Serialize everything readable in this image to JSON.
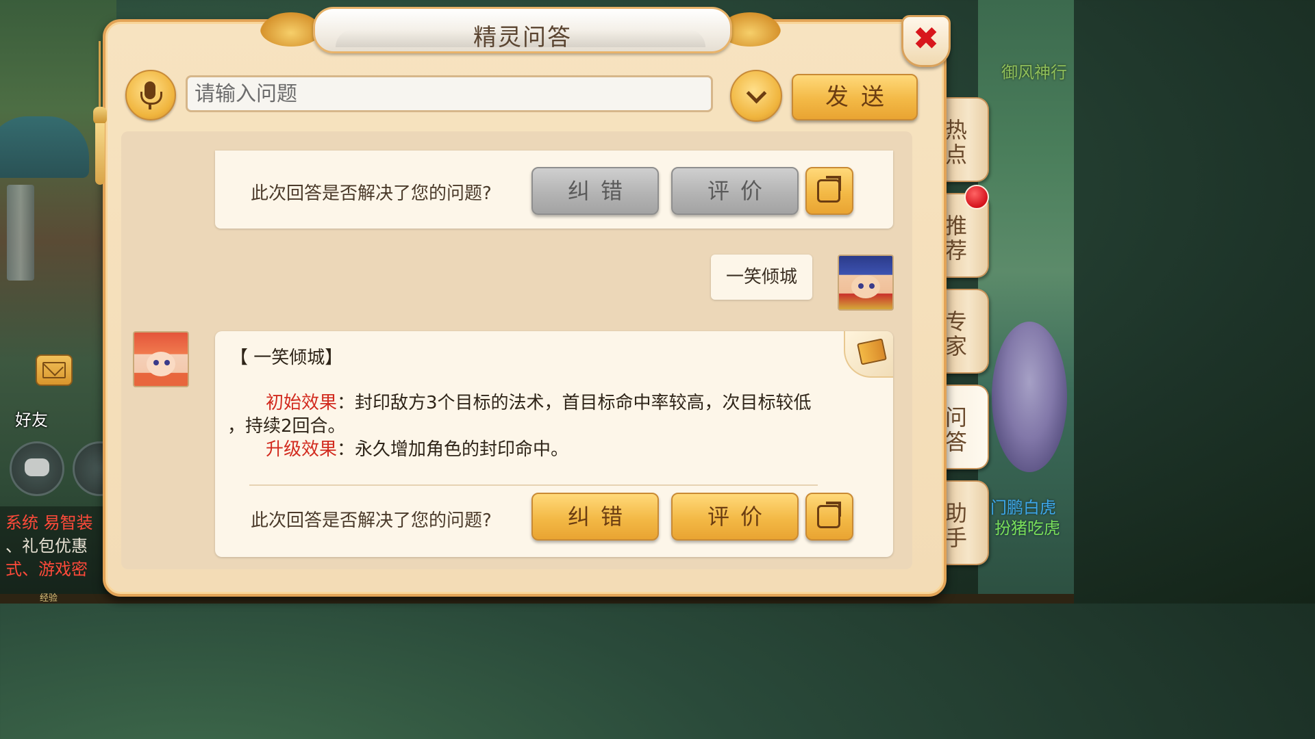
{
  "dialog": {
    "title": "精灵问答",
    "close_symbol": "✖",
    "input_placeholder": "请输入问题",
    "send_label": "发送"
  },
  "side_tabs": [
    "热点",
    "推荐",
    "专家",
    "问答",
    "助手"
  ],
  "active_tab": "问答",
  "background": {
    "top_right_text": "御风神行",
    "right_text_1": "门鹏白虎",
    "right_text_2": "扮猪吃虎",
    "friends_label": "好友",
    "chat_lines": [
      "系统 易智装",
      "、礼包优惠",
      "式、游戏密"
    ],
    "exp_label": "经验"
  },
  "conversation": {
    "feedback_question": "此次回答是否解决了您的问题?",
    "correct_label": "纠错",
    "rate_label": "评价",
    "user_message": "一笑倾城",
    "answer": {
      "header": "【 一笑倾城】",
      "initial_label": "初始效果",
      "initial_text": "：封印敌方3个目标的法术，首目标命中率较高，次目标较低",
      "initial_text_wrap": "，持续2回合。",
      "upgrade_label": "升级效果",
      "upgrade_text": "：永久增加角色的封印命中。"
    }
  },
  "colors": {
    "accent_gold": "#f3b946",
    "highlight_red": "#d22b1f",
    "close_red": "#d8161c"
  }
}
